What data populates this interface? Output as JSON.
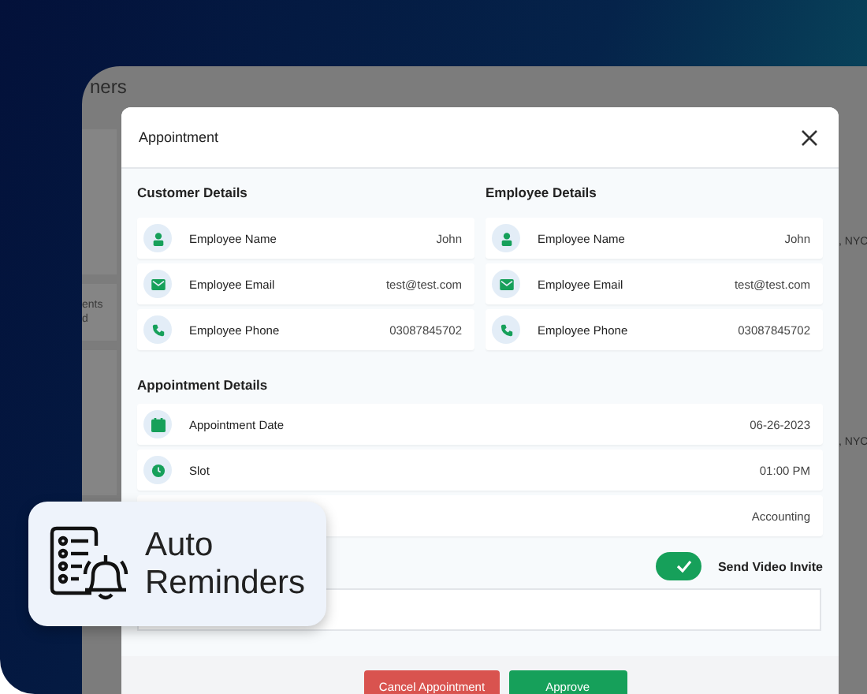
{
  "background_app": {
    "title_fragment": "ners",
    "left_fragments": [
      "ents",
      "d"
    ],
    "right_fragments": [
      ", NYC",
      ", NYC"
    ]
  },
  "modal": {
    "title": "Appointment",
    "columns": [
      {
        "title": "Customer Details",
        "rows": [
          {
            "kind": "name",
            "label": "Employee Name",
            "value": "John"
          },
          {
            "kind": "email",
            "label": "Employee Email",
            "value": "test@test.com"
          },
          {
            "kind": "phone",
            "label": "Employee Phone",
            "value": "03087845702"
          }
        ]
      },
      {
        "title": "Employee Details",
        "rows": [
          {
            "kind": "name",
            "label": "Employee Name",
            "value": "John"
          },
          {
            "kind": "email",
            "label": "Employee Email",
            "value": "test@test.com"
          },
          {
            "kind": "phone",
            "label": "Employee Phone",
            "value": "03087845702"
          }
        ]
      }
    ],
    "appointment": {
      "title": "Appointment Details",
      "rows": [
        {
          "kind": "date",
          "label": "Appointment Date",
          "value": "06-26-2023"
        },
        {
          "kind": "slot",
          "label": "Slot",
          "value": "01:00 PM"
        },
        {
          "kind": "department",
          "value": "Accounting"
        }
      ]
    },
    "video_invite": {
      "label": "Send Video Invite",
      "on": true
    },
    "buttons": [
      {
        "kind": "cancel",
        "label": "Cancel Appointment"
      },
      {
        "kind": "approve",
        "label": "Approve"
      }
    ]
  },
  "badge": {
    "lines": [
      "Auto",
      "Reminders"
    ]
  }
}
